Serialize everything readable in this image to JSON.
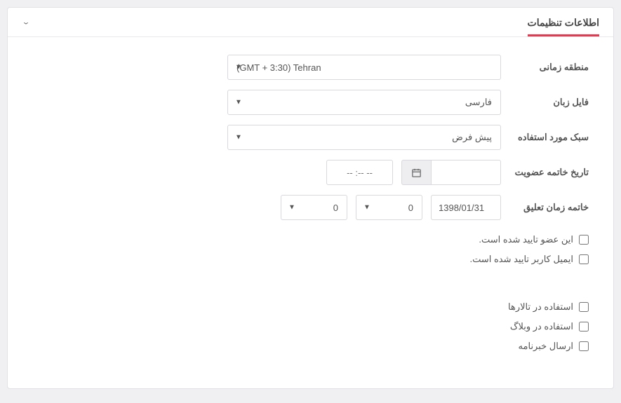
{
  "panel": {
    "title": "اطلاعات تنظیمات"
  },
  "fields": {
    "timezone": {
      "label": "منطقه زمانی",
      "value": "(GMT + 3:30) Tehran"
    },
    "language": {
      "label": "فایل زبان",
      "value": "فارسی"
    },
    "style": {
      "label": "سبک مورد استفاده",
      "value": "پیش فرض"
    },
    "expiry": {
      "label": "تاریخ خاتمه عضویت",
      "date_value": "",
      "time_placeholder": "-- :-- --"
    },
    "suspend": {
      "label": "خاتمه زمان تعلیق",
      "date_value": "1398/01/31",
      "sel1": "0",
      "sel2": "0"
    }
  },
  "checkboxes": {
    "approved": "این عضو تایید شده است.",
    "email_confirmed": "ایمیل کاربر تایید شده است.",
    "use_forums": "استفاده در تالارها",
    "use_blog": "استفاده در وبلاگ",
    "newsletter": "ارسال خبرنامه"
  }
}
